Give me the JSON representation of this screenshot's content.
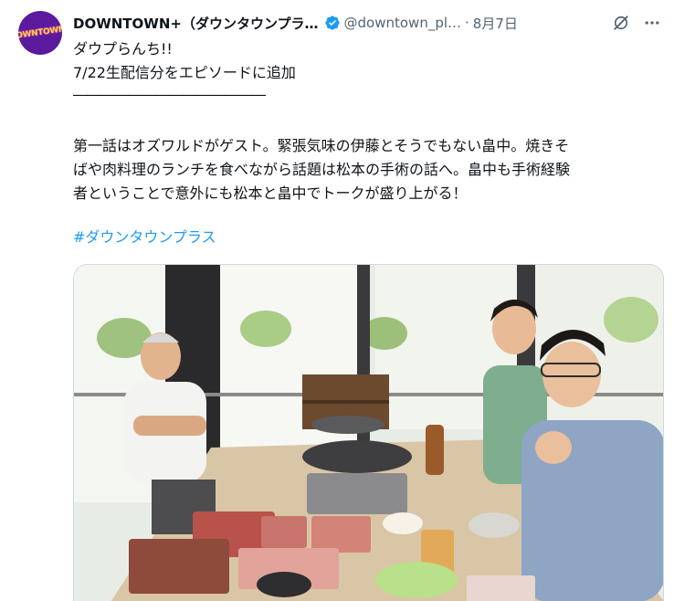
{
  "tweet": {
    "display_name": "DOWNTOWN+（ダウンタウンプラ…",
    "handle": "@downtown_pl…",
    "separator": "·",
    "date": "8月7日",
    "avatar_logo": "DOWNTOWN+",
    "lines": [
      "ダウプらんち!!",
      "7/22生配信分をエピソードに追加",
      "――――――――――――――",
      "第一話はオズワルドがゲスト。緊張気味の伊藤とそうでもない畠中。焼きそ",
      "ばや肉料理のランチを食べながら話題は松本の手術の話へ。畠中も手術経験",
      "者ということで意外にも松本と畠中でトークが盛り上がる！"
    ],
    "hashtag": "#ダウンタウンプラス"
  },
  "icons": {
    "verified": "verified-badge-icon",
    "grok": "grok-icon",
    "more": "more-options-icon"
  },
  "colors": {
    "text": "#0f1419",
    "secondary": "#536471",
    "link": "#1d9bf0",
    "avatar_bg": "#5b1a9e"
  }
}
